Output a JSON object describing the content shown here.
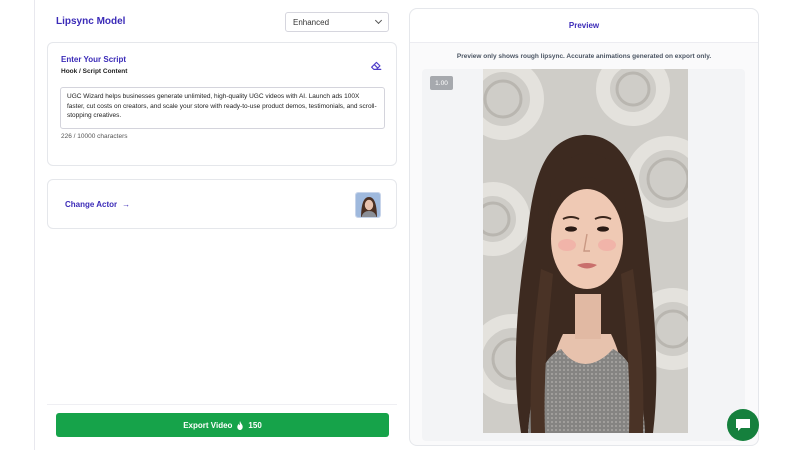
{
  "model": {
    "title": "Lipsync Model",
    "selected": "Enhanced"
  },
  "script": {
    "title": "Enter Your Script",
    "subtitle": "Hook / Script Content",
    "text": "UGC Wizard helps businesses generate unlimited, high-quality UGC videos with AI. Launch ads 100X faster, cut costs on creators, and scale your store with ready-to-use product demos, testimonials, and scroll-stopping creatives.",
    "char_count": "226 / 10000 characters"
  },
  "actor": {
    "label": "Change Actor",
    "arrow": "→"
  },
  "export": {
    "label": "Export Video",
    "cost": "150"
  },
  "preview": {
    "title": "Preview",
    "note": "Preview only shows rough lipsync. Accurate animations generated on export only.",
    "speed": "1.00"
  },
  "colors": {
    "accent": "#3b2bb8",
    "export_green": "#16a34a",
    "chat_green": "#15803d"
  },
  "icons": [
    "chevron-down-icon",
    "eraser-icon",
    "arrow-right-icon",
    "flame-icon",
    "chat-icon"
  ]
}
